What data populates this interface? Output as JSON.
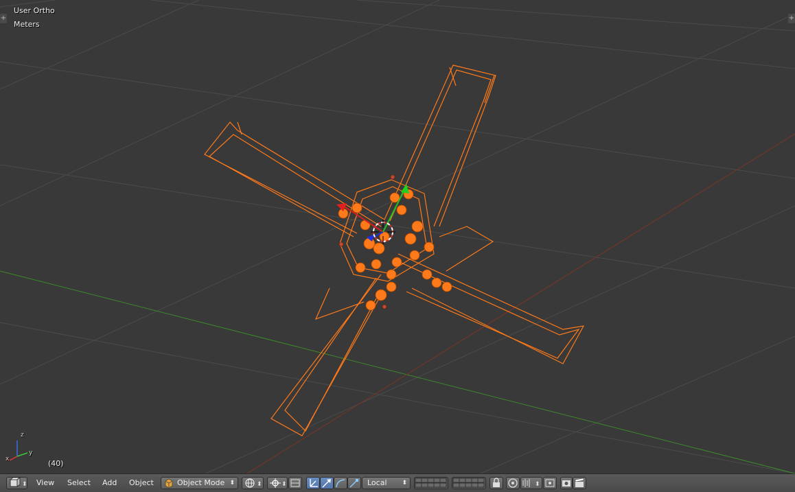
{
  "viewport": {
    "view_name": "User Ortho",
    "units": "Meters",
    "frame": "(40)",
    "axis_labels": {
      "z": "z",
      "y": "y",
      "x": "x"
    }
  },
  "colors": {
    "background": "#393939",
    "grid": "#4b4b4b",
    "x_axis": "#8a3a2a",
    "y_axis": "#3a8a2a",
    "wire_selected": "#ff7a1a",
    "header": "#4a4a4a"
  },
  "header": {
    "editor_type_icon": "3d-view-icon",
    "menus": {
      "view": "View",
      "select": "Select",
      "add": "Add",
      "object": "Object"
    },
    "mode": "Object Mode",
    "shading_icon": "sphere-shading-icon",
    "pivot_icon": "pivot-point-icon",
    "orientation": "Local"
  }
}
